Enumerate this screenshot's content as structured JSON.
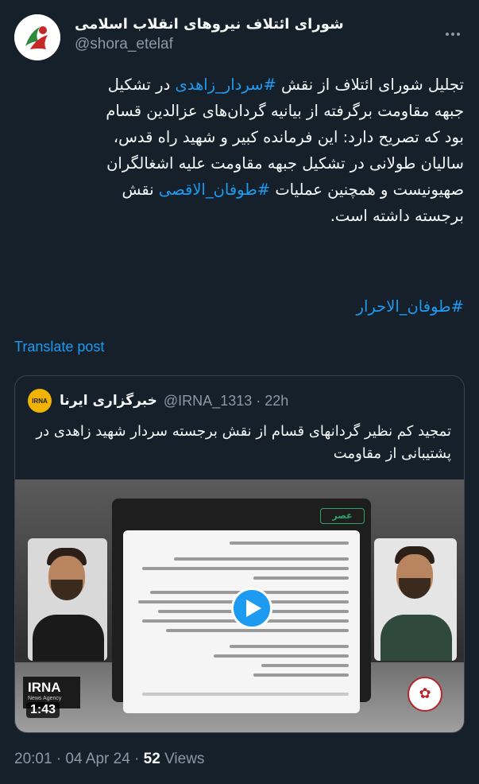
{
  "account": {
    "display_name": "شورای ائتلاف نیروهای انقلاب اسلامی",
    "handle": "@shora_etelaf"
  },
  "tweet": {
    "lines": [
      {
        "pre": "تجلیل شورای ائتلاف از نقش ",
        "tag": "#سردار_زاهدی",
        "post": " در تشکیل"
      },
      {
        "pre": "جبهه مقاومت برگرفته از بیانیه گردان‌های عزالدین قسام",
        "tag": "",
        "post": ""
      },
      {
        "pre": "بود که تصریح دارد: این فرمانده کبیر و شهید راه قدس،",
        "tag": "",
        "post": ""
      },
      {
        "pre": "سالیان طولانی در تشکیل جبهه مقاومت علیه اشغالگران",
        "tag": "",
        "post": ""
      },
      {
        "pre": "صهیونیست و همچنین عملیات ",
        "tag": "#طوفان_الاقصی",
        "post": " نقش"
      },
      {
        "pre": "برجسته داشته است.",
        "tag": "",
        "post": ""
      }
    ],
    "hashtag_line": "#طوفان_الاحرار",
    "translate_label": "Translate post"
  },
  "quoted": {
    "avatar_text": "IRNA",
    "name": "خبرگزاری ایرنا",
    "handle": "@IRNA_1313 · 22h",
    "text": "تمجید کم نظیر گردانهای قسام از نقش برجسته سردار شهید زاهدی در پشتیبانی از مقاومت",
    "media": {
      "duration": "1:43",
      "logo": "IRNA",
      "logo_sub": "News Agency",
      "doc_tag": "عصر"
    }
  },
  "meta": {
    "time": "20:01 · 04 Apr 24 · ",
    "views_count": "52",
    "views_label": " Views"
  },
  "colors": {
    "background": "#15202b",
    "link": "#1d9bf0",
    "muted": "#8b98a5",
    "border": "#38444d"
  }
}
